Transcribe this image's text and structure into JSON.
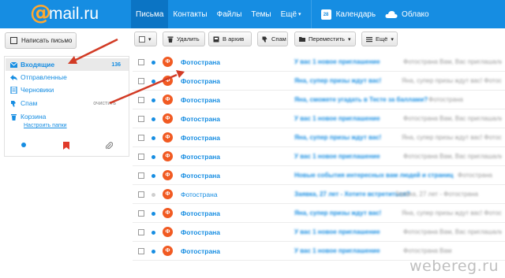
{
  "header": {
    "logo_at": "@",
    "logo_word": "mail.ru",
    "nav": [
      "Письма",
      "Контакты",
      "Файлы",
      "Темы",
      "Ещё"
    ],
    "more_caret": "▾",
    "calendar_day": "28",
    "calendar_label": "Календарь",
    "cloud_label": "Облако"
  },
  "compose": {
    "label": "Написать письмо"
  },
  "sidebar": {
    "folders": [
      {
        "label": "Входящие",
        "count": "136",
        "icon": "envelope-icon"
      },
      {
        "label": "Отправленные",
        "icon": "reply-icon"
      },
      {
        "label": "Черновики",
        "icon": "draft-icon"
      },
      {
        "label": "Спам",
        "clear": "очистить",
        "icon": "thumbs-down-icon"
      },
      {
        "label": "Корзина",
        "icon": "trash-icon"
      }
    ],
    "settings_link": "Настроить папки"
  },
  "toolbar": {
    "delete": "Удалить",
    "archive": "В архив",
    "spam": "Спам",
    "move": "Переместить",
    "more": "Ещё",
    "caret": "▾"
  },
  "messages": [
    {
      "sender": "Фотострана",
      "avatar": "Ф",
      "subject": "У вас 1 новое приглашение",
      "preview": "Фотострана Вам, Вас приглашали в группу",
      "unread": true
    },
    {
      "sender": "Фотострана",
      "avatar": "Ф",
      "subject": "Яна, супер призы ждут вас!",
      "preview": "Яна, супер призы ждут вас! Фотострана",
      "unread": true
    },
    {
      "sender": "Фотострана",
      "avatar": "Ф",
      "subject": "Яна, сможете угадать в Тесте за баллами?",
      "preview": "Фотострана",
      "unread": true
    },
    {
      "sender": "Фотострана",
      "avatar": "Ф",
      "subject": "У вас 1 новое приглашение",
      "preview": "Фотострана Вам, Вас приглашали в группу",
      "unread": true
    },
    {
      "sender": "Фотострана",
      "avatar": "Ф",
      "subject": "Яна, супер призы ждут вас!",
      "preview": "Яна, супер призы ждут вас! Фотострана",
      "unread": true
    },
    {
      "sender": "Фотострана",
      "avatar": "Ф",
      "subject": "У вас 1 новое приглашение",
      "preview": "Фотострана Вам, Вас приглашали в группу",
      "unread": true
    },
    {
      "sender": "Фотострана",
      "avatar": "Ф",
      "subject": "Новые события интересных вам людей и страниц",
      "preview": "Фотострана",
      "unread": true
    },
    {
      "sender": "Фотострана",
      "avatar": "Ф",
      "subject": "Заявка, 27 лет - Хотите встретиться?",
      "preview": "Заявка, 27 лет - Фотострана",
      "unread": false
    },
    {
      "sender": "Фотострана",
      "avatar": "Ф",
      "subject": "Яна, супер призы ждут вас!",
      "preview": "Яна, супер призы ждут вас! Фотострана",
      "unread": true
    },
    {
      "sender": "Фотострана",
      "avatar": "Ф",
      "subject": "У вас 1 новое приглашение",
      "preview": "Фотострана Вам, Вас приглашали в группу",
      "unread": true
    },
    {
      "sender": "Фотострана",
      "avatar": "Ф",
      "subject": "У вас 1 новое приглашение",
      "preview": "Фотострана Вам",
      "unread": true
    }
  ],
  "watermark": "webereg.ru",
  "colors": {
    "brand_blue": "#168de2",
    "logo_orange": "#ffa930",
    "avatar_orange": "#f15a22",
    "arrow_red": "#d23b25"
  }
}
